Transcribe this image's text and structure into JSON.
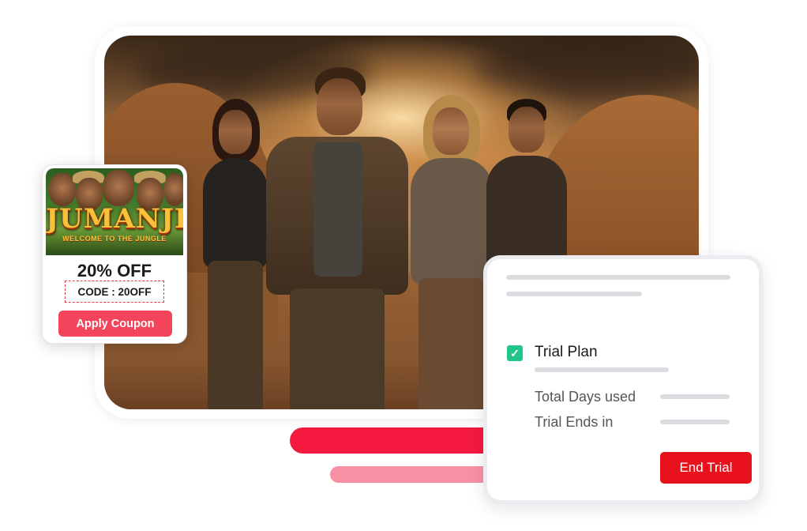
{
  "coupon": {
    "poster_title": "JUMANJI",
    "poster_subtitle": "WELCOME TO THE JUNGLE",
    "discount": "20% OFF",
    "code": "CODE : 20OFF",
    "apply_label": "Apply Coupon"
  },
  "trial": {
    "plan_label": "Trial Plan",
    "plan_checked": true,
    "days_used_label": "Total Days used",
    "ends_label": "Trial Ends in",
    "end_button_label": "End Trial"
  },
  "colors": {
    "accent_red": "#e8111c",
    "coupon_red": "#f2445a",
    "check_green": "#21c58a",
    "bar_red": "#f5193f",
    "bar_pink": "#f890a4"
  }
}
